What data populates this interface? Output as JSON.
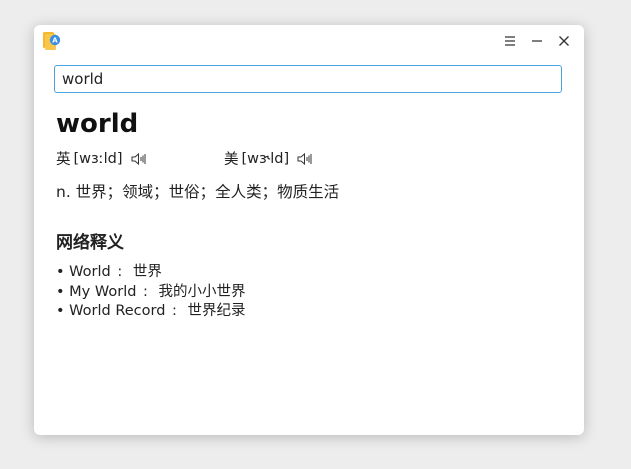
{
  "titlebar": {
    "icons": {
      "app": "dictionary-app-icon",
      "menu": "menu-icon",
      "minimize": "minimize-icon",
      "close": "close-icon"
    }
  },
  "search": {
    "value": "world",
    "placeholder": ""
  },
  "entry": {
    "word": "world",
    "phonetics": {
      "uk": {
        "region": "英",
        "ipa": "[wɜːld]"
      },
      "us": {
        "region": "美",
        "ipa": "[wɝld]"
      }
    },
    "definition": "n. 世界；领域；世俗；全人类；物质生活"
  },
  "web_definitions": {
    "title": "网络释义",
    "bullet": "•",
    "separator": ":",
    "items": [
      {
        "term": "World",
        "meaning": "世界"
      },
      {
        "term": "My World",
        "meaning": "我的小小世界"
      },
      {
        "term": "World Record",
        "meaning": "世界纪录"
      }
    ]
  },
  "colors": {
    "accent": "#4aa3df",
    "text": "#222222",
    "background": "#ffffff"
  }
}
